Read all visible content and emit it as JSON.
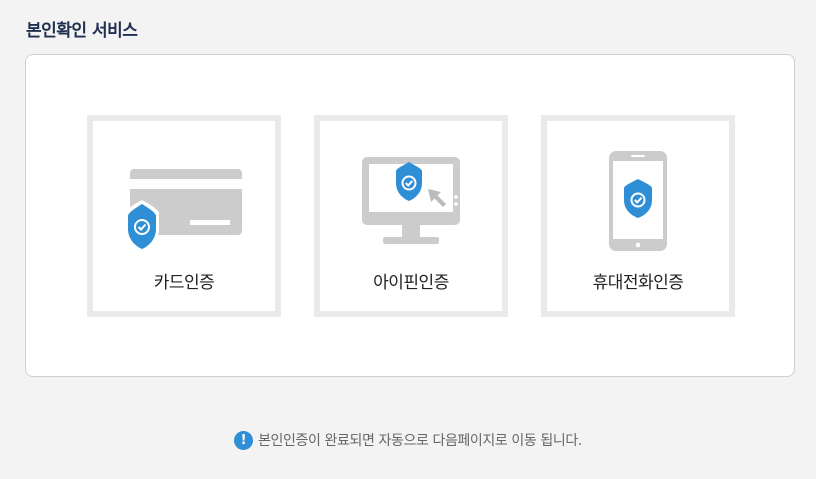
{
  "header": {
    "title": "본인확인 서비스"
  },
  "options": [
    {
      "label": "카드인증",
      "icon": "credit-card-shield-icon"
    },
    {
      "label": "아이핀인증",
      "icon": "monitor-shield-icon"
    },
    {
      "label": "휴대전화인증",
      "icon": "mobile-phone-shield-icon"
    }
  ],
  "notice": {
    "icon": "exclamation-icon",
    "text": "본인인증이 완료되면 자동으로 다음페이지로 이동 됩니다."
  },
  "colors": {
    "title": "#1f2f4f",
    "shield": "#2f8fd6",
    "device_gray": "#cccccc",
    "option_border": "#eaeaea",
    "background": "#f3f3f3"
  }
}
